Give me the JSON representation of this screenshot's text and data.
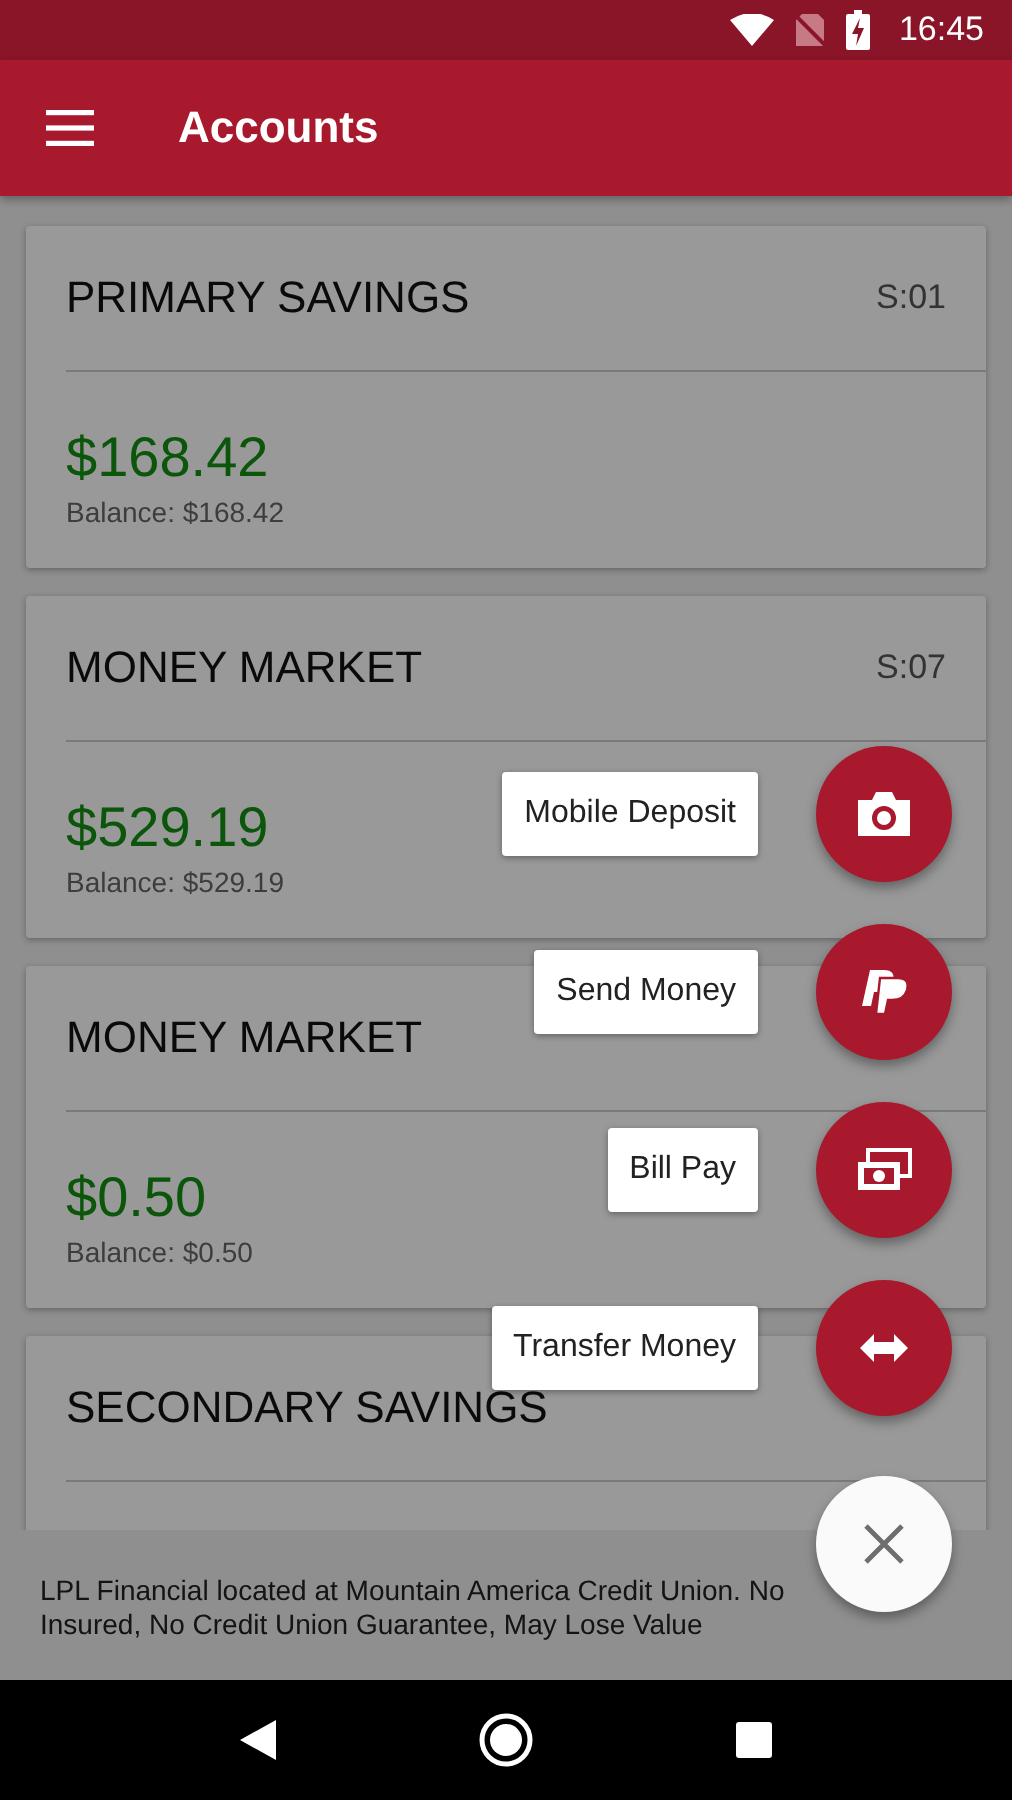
{
  "status_bar": {
    "time": "16:45"
  },
  "app_bar": {
    "title": "Accounts"
  },
  "accounts": [
    {
      "name": "PRIMARY SAVINGS",
      "code": "S:01",
      "amount": "$168.42",
      "balance": "Balance: $168.42"
    },
    {
      "name": "MONEY MARKET",
      "code": "S:07",
      "amount": "$529.19",
      "balance": "Balance: $529.19"
    },
    {
      "name": "MONEY MARKET",
      "amount": "$0.50",
      "balance": "Balance: $0.50"
    },
    {
      "name": "SECONDARY SAVINGS"
    }
  ],
  "footer": {
    "lines": [
      "LPL Financial located at Mountain America Credit Union. No",
      "Insured, No Credit Union Guarantee, May Lose Value"
    ]
  },
  "speed_dial": {
    "open": true,
    "actions": [
      {
        "kind": "camera",
        "label": "Mobile Deposit"
      },
      {
        "kind": "paypal",
        "label": "Send Money"
      },
      {
        "kind": "bills",
        "label": "Bill Pay"
      },
      {
        "kind": "transfer",
        "label": "Transfer Money"
      }
    ]
  }
}
